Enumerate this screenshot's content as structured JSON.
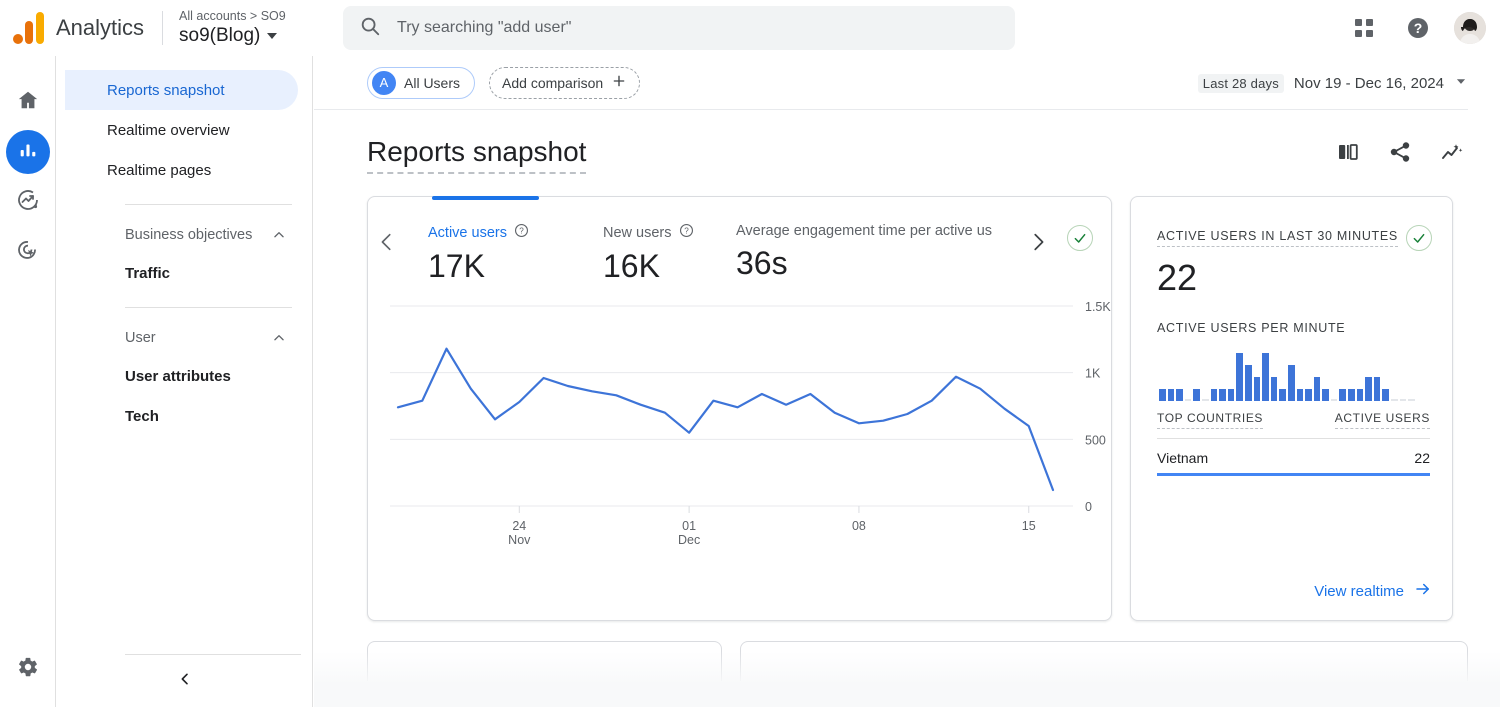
{
  "header": {
    "brand": "Analytics",
    "account_breadcrumb": "All accounts > SO9",
    "property_name": "so9(Blog)",
    "search_placeholder": "Try searching \"add user\"",
    "search_value": "",
    "apps_icon": "apps-grid-icon",
    "help_icon": "help-icon",
    "avatar_icon": "user-avatar"
  },
  "rail": {
    "items": [
      {
        "name": "home",
        "icon": "home-icon",
        "active": false
      },
      {
        "name": "reports",
        "icon": "bar-chart-icon",
        "active": true
      },
      {
        "name": "explore",
        "icon": "explore-icon",
        "active": false
      },
      {
        "name": "advertising",
        "icon": "advertising-target-icon",
        "active": false
      }
    ],
    "settings_icon": "gear-icon"
  },
  "nav": {
    "items": [
      {
        "label": "Reports snapshot",
        "selected": true
      },
      {
        "label": "Realtime overview",
        "selected": false
      },
      {
        "label": "Realtime pages",
        "selected": false
      }
    ],
    "sections": [
      {
        "title": "Business objectives",
        "collapse_icon": "chevron-up-icon",
        "children": [
          {
            "label": "Traffic"
          }
        ]
      },
      {
        "title": "User",
        "collapse_icon": "chevron-up-icon",
        "children": [
          {
            "label": "User attributes"
          },
          {
            "label": "Tech"
          }
        ]
      }
    ],
    "collapse_icon": "chevron-left-icon"
  },
  "filters": {
    "all_users_chip": {
      "avatar_letter": "A",
      "label": "All Users"
    },
    "add_comparison": {
      "label": "Add comparison",
      "icon": "plus-icon"
    },
    "date_range": {
      "badge": "Last 28 days",
      "text": "Nov 19 - Dec 16, 2024",
      "dropdown_icon": "chevron-down-icon"
    }
  },
  "page": {
    "title": "Reports snapshot",
    "actions": [
      {
        "name": "compare-icon",
        "label": "Compare"
      },
      {
        "name": "share-icon",
        "label": "Share this report"
      },
      {
        "name": "insights-icon",
        "label": "Insights"
      }
    ]
  },
  "metrics_card": {
    "prev_icon": "chevron-left-icon",
    "next_icon": "chevron-right-icon",
    "status_icon": "check-circle-icon",
    "metrics": [
      {
        "label": "Active users",
        "value": "17K",
        "active": true,
        "info_icon": "info-icon"
      },
      {
        "label": "New users",
        "value": "16K",
        "active": false,
        "info_icon": "info-icon"
      },
      {
        "label": "Average engagement time per active us",
        "value": "36s",
        "active": false,
        "info_icon": null
      }
    ]
  },
  "realtime_card": {
    "headline_label": "ACTIVE USERS IN LAST 30 MINUTES",
    "headline_value": "22",
    "status_icon": "check-circle-icon",
    "per_minute_label": "ACTIVE USERS PER MINUTE",
    "table": {
      "col_country": "TOP COUNTRIES",
      "col_users": "ACTIVE USERS",
      "rows": [
        {
          "country": "Vietnam",
          "users": "22",
          "share_pct": 100
        }
      ]
    },
    "view_link": {
      "label": "View realtime",
      "icon": "arrow-right-icon"
    }
  },
  "chart_data": [
    {
      "type": "line",
      "title": "Active users",
      "xlabel": "",
      "ylabel": "",
      "ylim": [
        0,
        1500
      ],
      "yticks": [
        0,
        500,
        1000,
        1500
      ],
      "ytick_labels": [
        "0",
        "500",
        "1K",
        "1.5K"
      ],
      "grid": true,
      "legend": false,
      "line_color": "#3d74d8",
      "xtick_labels": [
        "24\nNov",
        "01\nDec",
        "08",
        "15"
      ],
      "xtick_indices": [
        5,
        12,
        19,
        26
      ],
      "x": [
        "Nov 19",
        "Nov 20",
        "Nov 21",
        "Nov 22",
        "Nov 23",
        "Nov 24",
        "Nov 25",
        "Nov 26",
        "Nov 27",
        "Nov 28",
        "Nov 29",
        "Nov 30",
        "Dec 01",
        "Dec 02",
        "Dec 03",
        "Dec 04",
        "Dec 05",
        "Dec 06",
        "Dec 07",
        "Dec 08",
        "Dec 09",
        "Dec 10",
        "Dec 11",
        "Dec 12",
        "Dec 13",
        "Dec 14",
        "Dec 15",
        "Dec 16"
      ],
      "values": [
        740,
        790,
        1180,
        880,
        650,
        780,
        960,
        900,
        860,
        830,
        760,
        700,
        550,
        790,
        740,
        840,
        760,
        840,
        700,
        620,
        640,
        690,
        790,
        970,
        880,
        730,
        600,
        120
      ]
    },
    {
      "type": "bar",
      "title": "ACTIVE USERS PER MINUTE",
      "xlabel": "",
      "ylabel": "",
      "ylim": [
        0,
        5
      ],
      "grid": false,
      "legend": false,
      "bar_color": "#3d74d8",
      "categories": [
        "-30",
        "-29",
        "-28",
        "-27",
        "-26",
        "-25",
        "-24",
        "-23",
        "-22",
        "-21",
        "-20",
        "-19",
        "-18",
        "-17",
        "-16",
        "-15",
        "-14",
        "-13",
        "-12",
        "-11",
        "-10",
        "-9",
        "-8",
        "-7",
        "-6",
        "-5",
        "-4",
        "-3",
        "-2",
        "-1"
      ],
      "values": [
        1,
        1,
        1,
        0,
        1,
        0,
        1,
        1,
        1,
        4,
        3,
        2,
        4,
        2,
        1,
        3,
        1,
        1,
        2,
        1,
        0,
        1,
        1,
        1,
        2,
        2,
        1,
        0,
        0,
        0
      ]
    }
  ],
  "colors": {
    "accent_blue": "#1a73e8",
    "chart_blue": "#3d74d8",
    "selected_bg": "#e8f0fe",
    "link_blue": "#1967d2",
    "ok_green": "#188038",
    "logo_orange": "#e8710a",
    "logo_amber": "#f9ab00"
  }
}
